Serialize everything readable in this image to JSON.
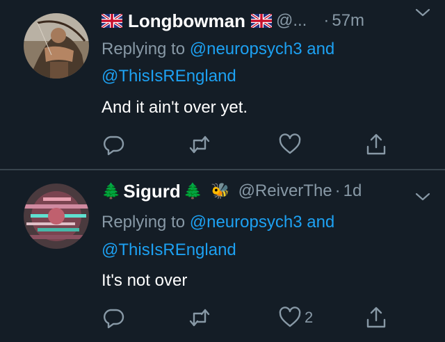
{
  "colors": {
    "background": "#141d26",
    "text_primary": "#ffffff",
    "text_secondary": "#8899a6",
    "link": "#1da1f2",
    "divider": "#38444d"
  },
  "tweets": [
    {
      "prefix_emoji": "flag-uk",
      "name": "Longbowman",
      "suffix_emoji": "flag-uk",
      "handle": "@...",
      "dot": "·",
      "time": "57m",
      "replying_prefix": "Replying to ",
      "mention_1": "@neuropsych3",
      "and": " and",
      "mention_2": "@ThisIsREngland",
      "text": "And it ain't over yet.",
      "like_count": ""
    },
    {
      "prefix_emoji": "🌲",
      "name": "Sigurd",
      "suffix_emoji": "🌲",
      "extra_emoji": "🐝",
      "handle": "@ReiverThe",
      "dot": "·",
      "time": "1d",
      "replying_prefix": "Replying to ",
      "mention_1": "@neuropsych3",
      "and": " and",
      "mention_2": "@ThisIsREngland",
      "text": "It's not over",
      "like_count": "2"
    }
  ],
  "icons": {
    "reply": "reply-icon",
    "retweet": "retweet-icon",
    "like": "heart-icon",
    "share": "share-icon",
    "more": "chevron-down-icon"
  }
}
